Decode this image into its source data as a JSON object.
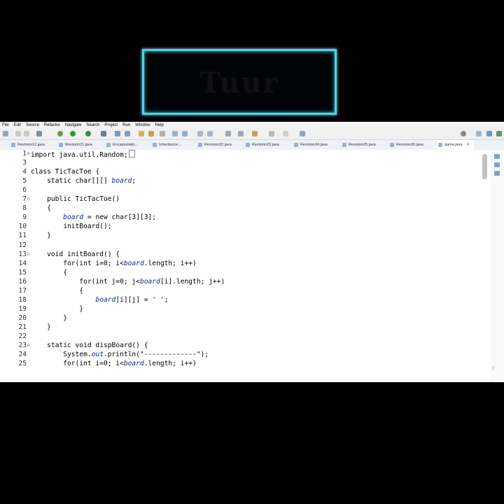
{
  "logo": {
    "text": "Tuur"
  },
  "menu": [
    "File",
    "Edit",
    "Source",
    "Refactor",
    "Navigate",
    "Search",
    "Project",
    "Run",
    "Window",
    "Help"
  ],
  "tabs": [
    {
      "label": "Revision12.java"
    },
    {
      "label": "Revision21.java"
    },
    {
      "label": "Encapsulatio..."
    },
    {
      "label": "Inheritance..."
    },
    {
      "label": "Revision22.java"
    },
    {
      "label": "Revision23.java"
    },
    {
      "label": "Revision24.java"
    },
    {
      "label": "Revision25.java"
    },
    {
      "label": "Revision26.java"
    },
    {
      "label": "game.java"
    }
  ],
  "active_tab_close": "✕",
  "code": [
    {
      "n": "1",
      "fold": "⊕",
      "t": "import java.util.Random;"
    },
    {
      "n": "3",
      "t": ""
    },
    {
      "n": "4",
      "t": "class TicTacToe {"
    },
    {
      "n": "5",
      "t": "    static char[][] ",
      "f": "board",
      ",": ";"
    },
    {
      "n": "6",
      "t": ""
    },
    {
      "n": "7",
      "fold": "⊖",
      "t": "    public TicTacToe()"
    },
    {
      "n": "8",
      "t": "    {"
    },
    {
      "n": "9",
      "t": "        ",
      "f": "board",
      "r": " = new char[3][3];"
    },
    {
      "n": "10",
      "t": "        initBoard();"
    },
    {
      "n": "11",
      "t": "    }"
    },
    {
      "n": "12",
      "t": ""
    },
    {
      "n": "13",
      "fold": "⊖",
      "t": "    void initBoard() {"
    },
    {
      "n": "14",
      "t": "        for(int i=0; i<",
      "f": "board",
      "r": ".length; i++)"
    },
    {
      "n": "15",
      "t": "        {"
    },
    {
      "n": "16",
      "t": "            for(int j=0; j<",
      "f": "board",
      "r": "[i].length; j++)"
    },
    {
      "n": "17",
      "t": "            {"
    },
    {
      "n": "18",
      "t": "                ",
      "f": "board",
      "r": "[i][j] = ' ';"
    },
    {
      "n": "19",
      "t": "            }"
    },
    {
      "n": "20",
      "t": "        }"
    },
    {
      "n": "21",
      "t": "    }"
    },
    {
      "n": "22",
      "t": ""
    },
    {
      "n": "23",
      "fold": "⊖",
      "t": "    static void dispBoard() {"
    },
    {
      "n": "24",
      "t": "        System.",
      "f": "out",
      "r": ".println(\"-------------\");"
    },
    {
      "n": "25",
      "t": "        for(int i=0; i<",
      "f": "board",
      "r": ".length; i++)"
    }
  ],
  "colors": {
    "field": "#0a2a8c",
    "accent": "#4fd1e8",
    "background": "#000000"
  }
}
